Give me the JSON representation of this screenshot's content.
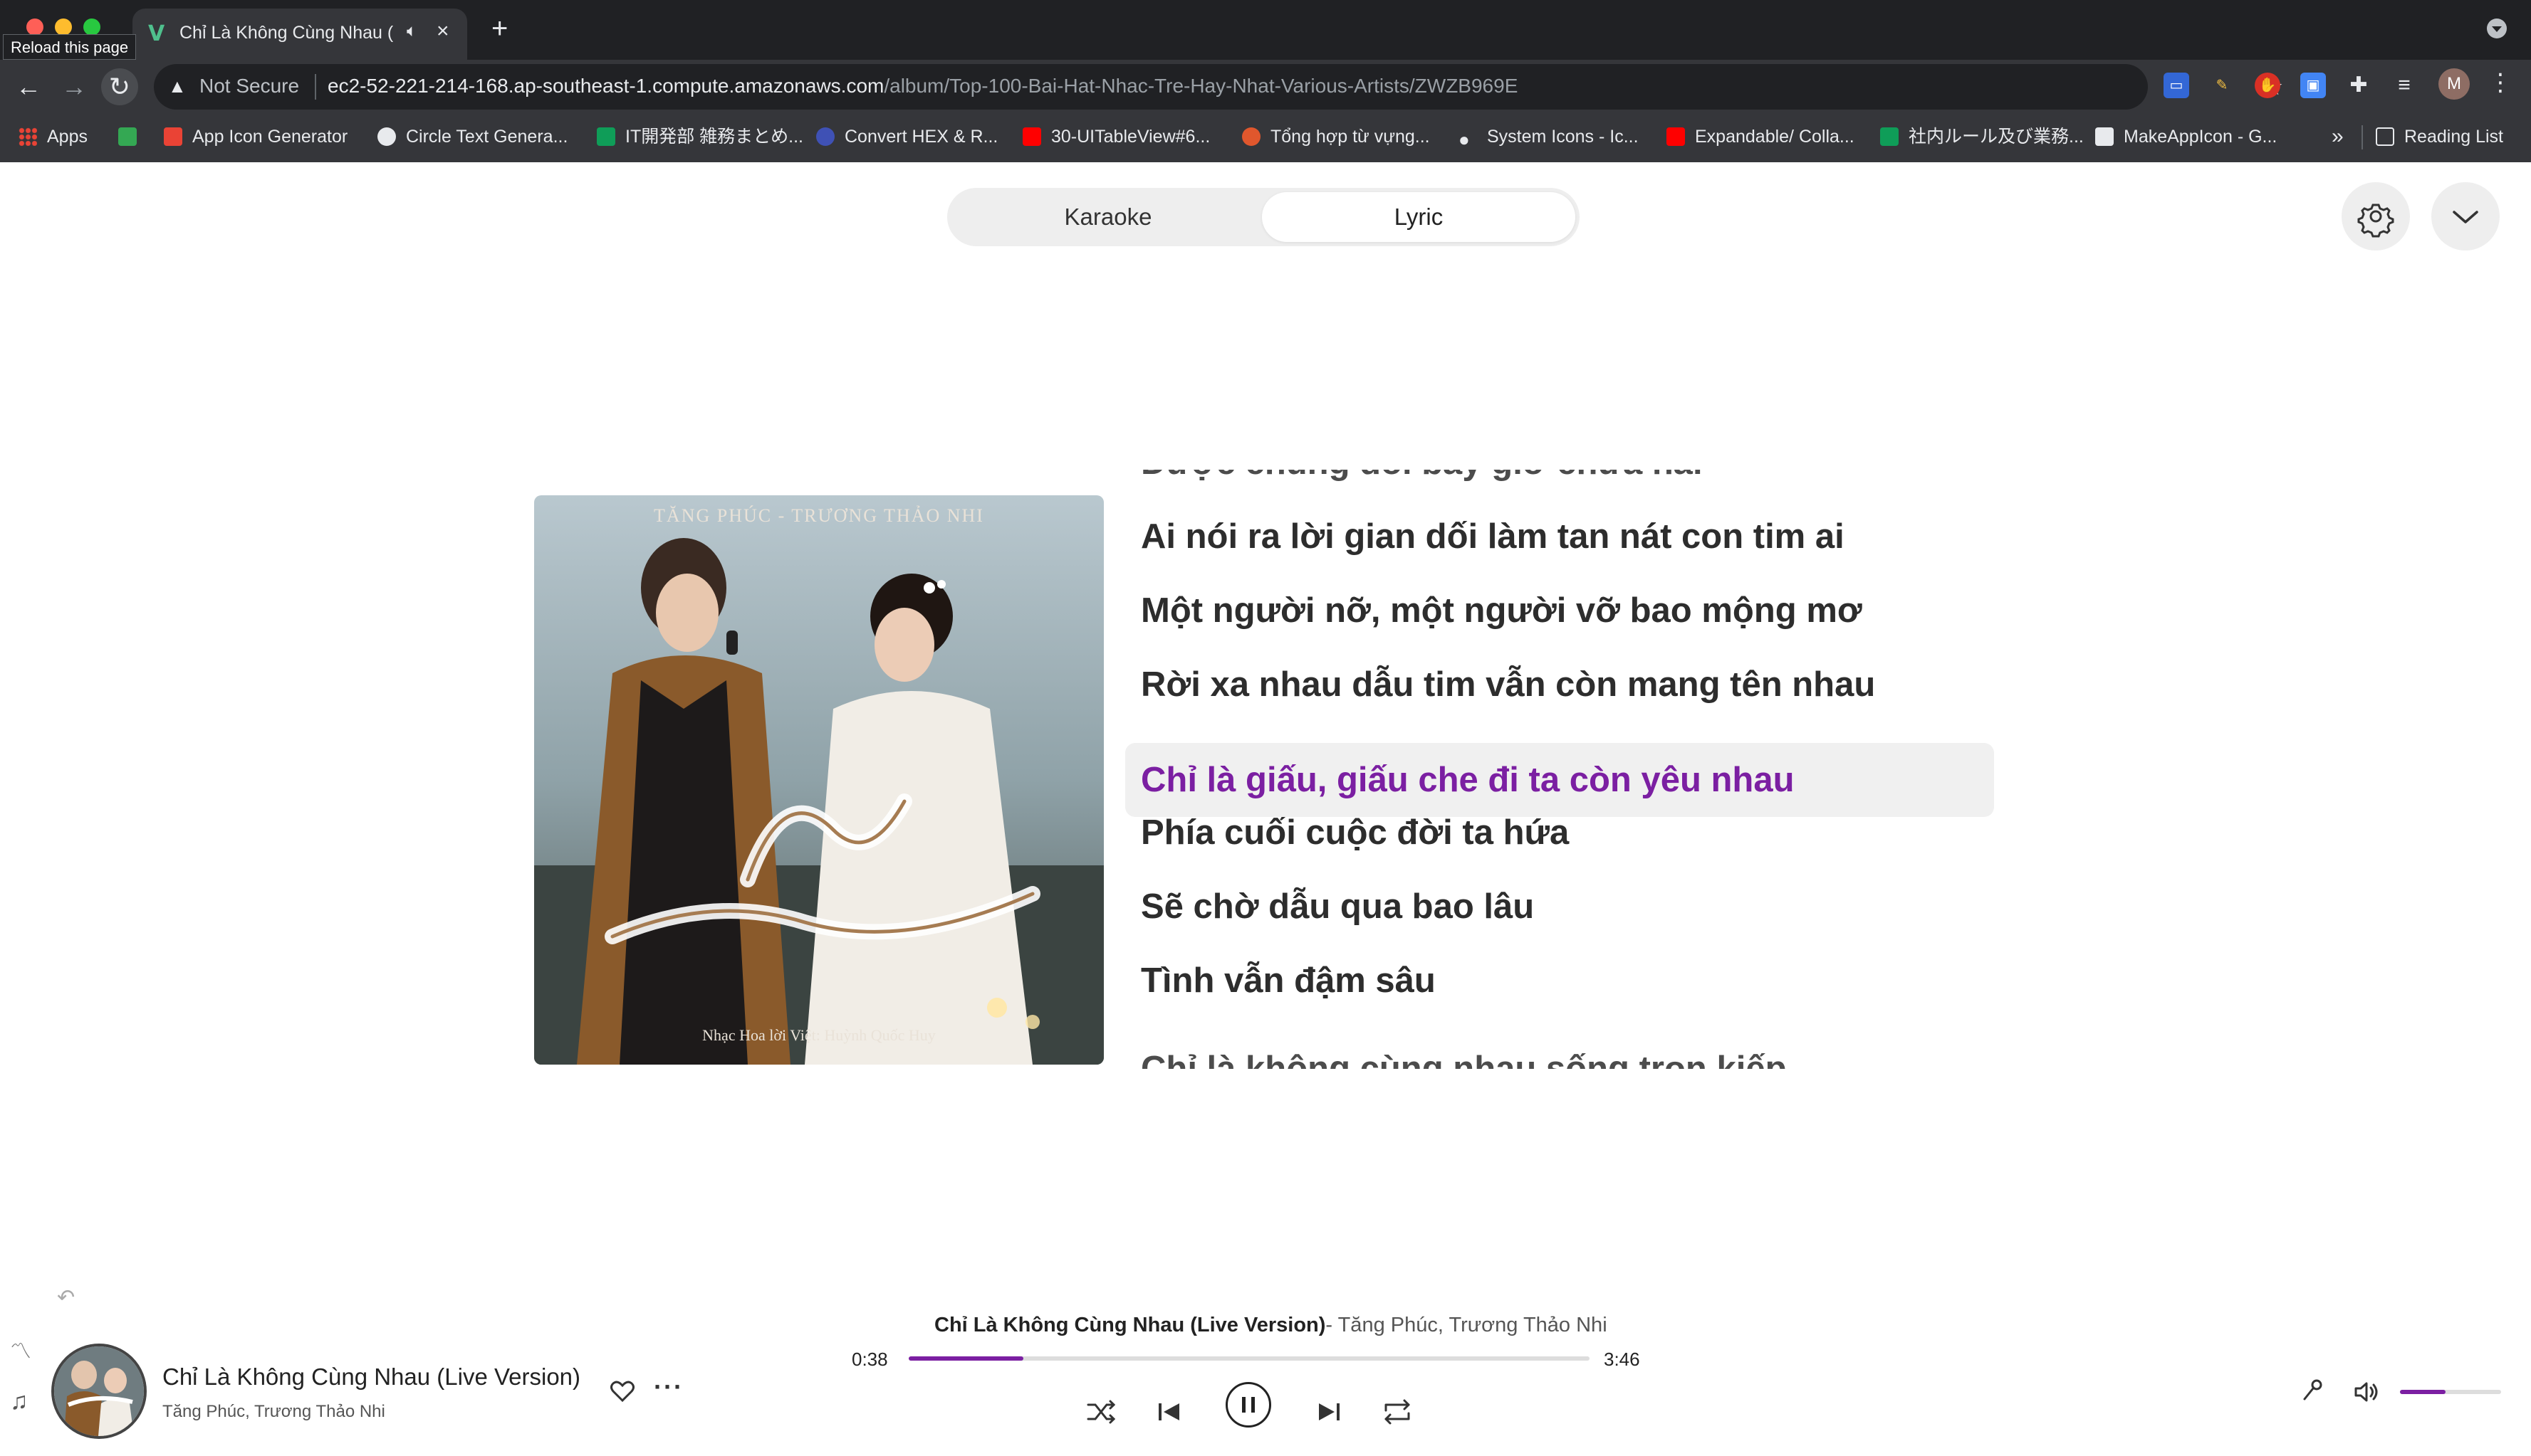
{
  "browser": {
    "tab_title": "Chỉ Là Không Cùng Nhau (",
    "tooltip": "Reload this page",
    "security_label": "Not Secure",
    "url_host": "ec2-52-221-214-168.ap-southeast-1.compute.amazonaws.com",
    "url_path": "/album/Top-100-Bai-Hat-Nhac-Tre-Hay-Nhat-Various-Artists/ZWZB969E",
    "profile_initial": "M",
    "bookmarks": [
      "Apps",
      "App Icon Generator",
      "Circle Text Genera...",
      "IT開発部 雑務まとめ...",
      "Convert HEX & R...",
      "30-UITableView#6...",
      "Tổng hợp từ vựng...",
      "System Icons - Ic...",
      "Expandable/ Colla...",
      "社内ルール及び業務...",
      "MakeAppIcon - G..."
    ],
    "bookmarks_overflow": "»",
    "reading_list": "Reading List"
  },
  "view_toggle": {
    "karaoke": "Karaoke",
    "lyric": "Lyric",
    "selected": "Lyric"
  },
  "album_cover": {
    "top_text": "TĂNG PHÚC - TRƯƠNG THẢO NHI",
    "script_line1": "chỉ là",
    "script_line2": "không cùng nhau",
    "bottom_text": "Nhạc Hoa lời Việt: Huỳnh Quốc Huy"
  },
  "lyrics": {
    "active_index": 4,
    "lines": [
      "Được chung đôi bây giờ chưa hài",
      "Ai nói ra lời gian dối làm tan nát con tim ai",
      "Một người nỡ, một người vỡ bao mộng mơ",
      "Rời xa nhau dẫu tim vẫn còn mang tên nhau",
      "Chỉ là giấu, giấu che đi ta còn yêu nhau",
      "Phía cuối cuộc đời ta hứa",
      "Sẽ chờ dẫu qua bao lâu",
      "Tình vẫn đậm sâu",
      "Chỉ là không cùng nhau sống trọn kiếp"
    ]
  },
  "player": {
    "song_title": "Chỉ Là Không Cùng Nhau (Live Version)",
    "artists": "Tăng Phúc, Trương Thảo Nhi",
    "now_playing_title": "Chỉ Là Không Cùng Nhau (Live Version)",
    "now_playing_artists": "- Tăng Phúc, Trương Thảo Nhi",
    "current_time": "0:38",
    "total_time": "3:46",
    "progress_fraction": 0.168,
    "volume_fraction": 0.45
  },
  "colors": {
    "accent": "#7b1fa2",
    "chrome_dark": "#202124",
    "chrome_toolbar": "#35363a"
  }
}
